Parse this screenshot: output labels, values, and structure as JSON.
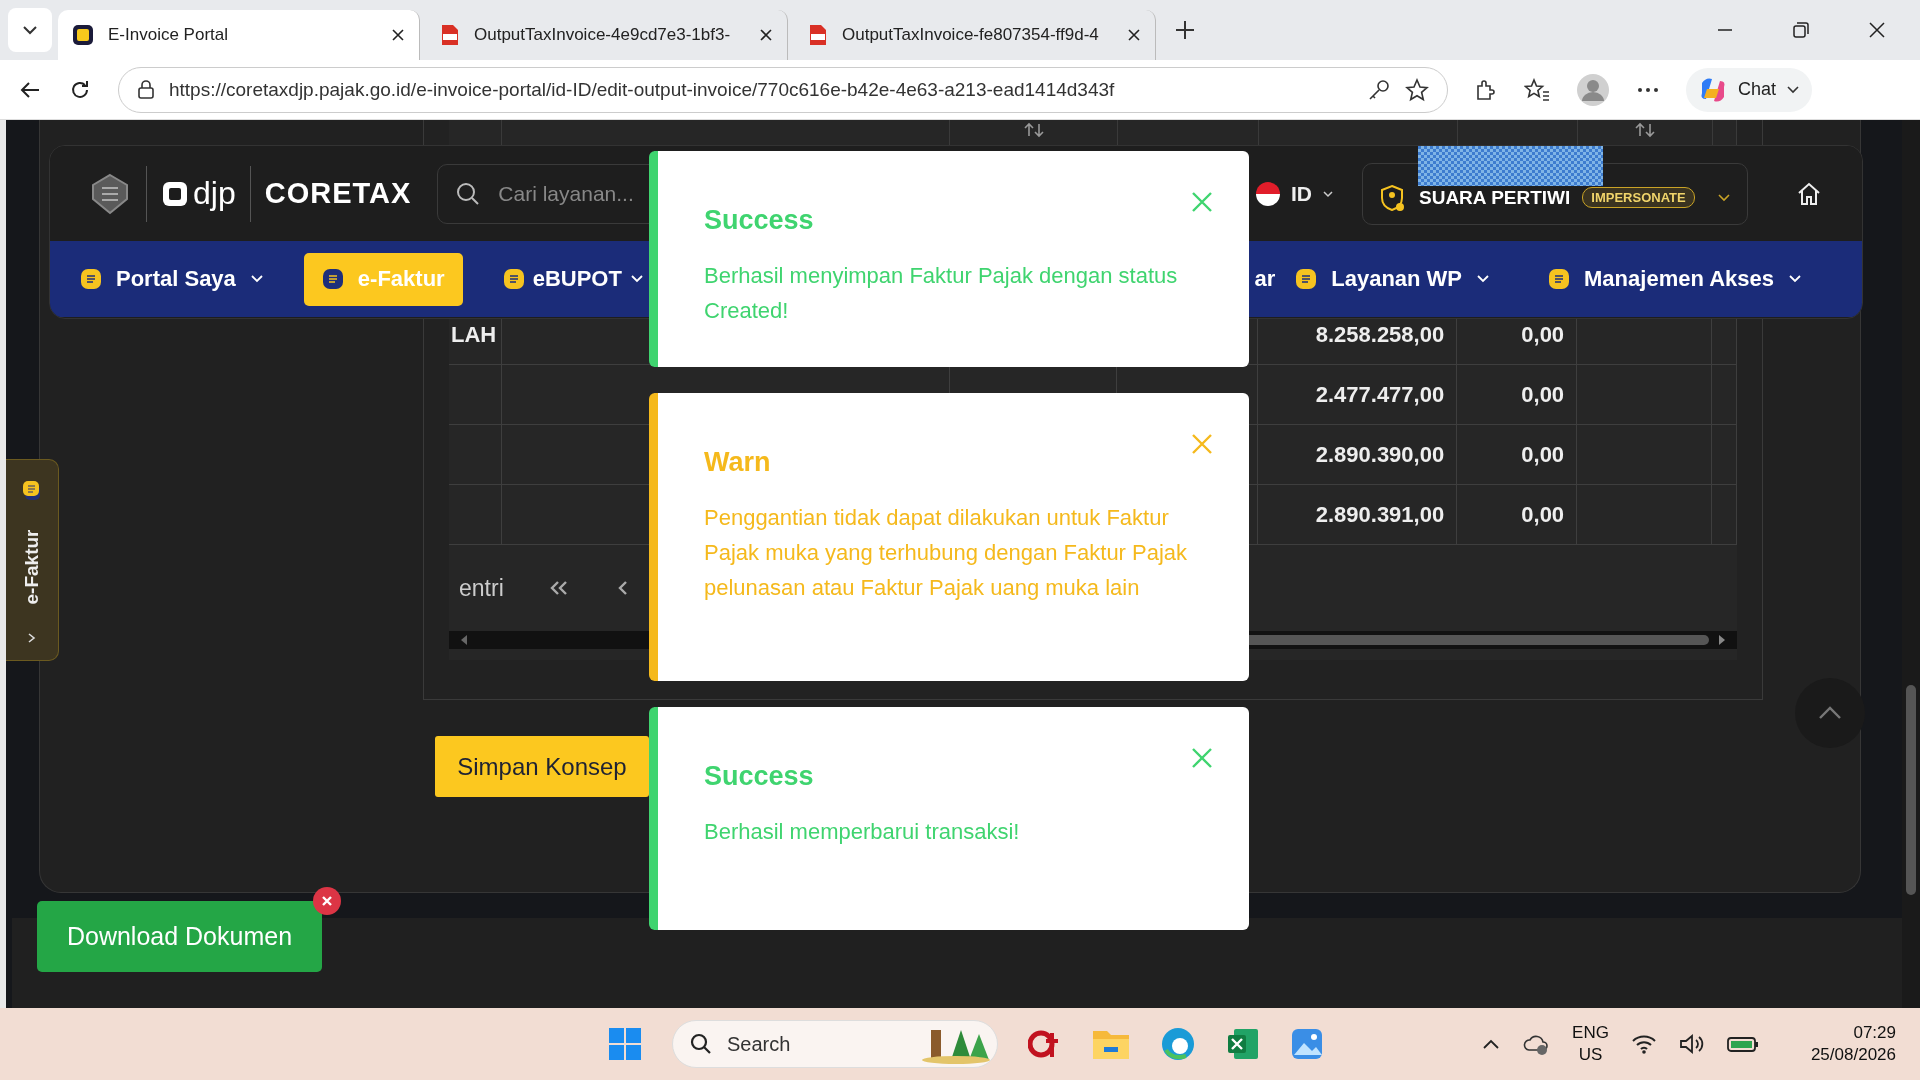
{
  "browser": {
    "tabs": [
      {
        "kind": "app",
        "title": "E-Invoice Portal",
        "selected": true
      },
      {
        "kind": "pdf",
        "title": "OutputTaxInvoice-4e9cd7e3-1bf3-",
        "selected": false
      },
      {
        "kind": "pdf",
        "title": "OutputTaxInvoice-fe807354-ff9d-4",
        "selected": false
      }
    ],
    "url": "https://coretaxdjp.pajak.go.id/e-invoice-portal/id-ID/edit-output-invoice/770c616e-b42e-4e63-a213-ead1414d343f",
    "chat_label": "Chat"
  },
  "header": {
    "logo_djp": "djp",
    "logo_coretax": "CORETAX",
    "search": {
      "placeholder": "Cari layanan..."
    },
    "language": "ID",
    "user_name": "SUARA PERTIWI",
    "user_badge": "IMPERSONATE"
  },
  "nav": [
    {
      "label": "Portal Saya",
      "icon": true,
      "caret": true,
      "selected": false
    },
    {
      "label": "e-Faktur",
      "icon": true,
      "caret": false,
      "selected": true
    },
    {
      "label": "eBUPOT",
      "icon": true,
      "caret": true,
      "selected": false
    },
    {
      "label": "ar",
      "icon": false,
      "caret": false,
      "selected": false
    },
    {
      "label": "Layanan WP",
      "icon": true,
      "caret": true,
      "selected": false
    },
    {
      "label": "Manajemen Akses",
      "icon": true,
      "caret": true,
      "selected": false
    }
  ],
  "side_tab": {
    "label": "e-Faktur"
  },
  "table": {
    "rows": [
      {
        "column_1": "LAH",
        "column_5": "8.258.258,00",
        "column_6": "0,00"
      },
      {
        "column_5": "2.477.477,00",
        "column_6": "0,00"
      },
      {
        "column_5": "2.890.390,00",
        "column_6": "0,00"
      },
      {
        "column_5": "2.890.391,00",
        "column_6": "0,00"
      }
    ],
    "pagination": {
      "entries_label": "entri"
    }
  },
  "buttons": {
    "save_draft": "Simpan Konsep",
    "download": "Download Dokumen"
  },
  "toasts": [
    {
      "kind": "success",
      "title": "Success",
      "message": "Berhasil menyimpan Faktur Pajak dengan status Created!"
    },
    {
      "kind": "warn",
      "title": "Warn",
      "message": "Penggantian tidak dapat dilakukan untuk Faktur Pajak muka yang terhubung dengan Faktur Pajak pelunasan atau Faktur Pajak uang muka lain"
    },
    {
      "kind": "success",
      "title": "Success",
      "message": "Berhasil memperbarui transaksi!"
    }
  ],
  "taskbar": {
    "search": "Search",
    "language": "ENG",
    "region": "US",
    "time": "07:29",
    "date": "25/08/2026"
  }
}
